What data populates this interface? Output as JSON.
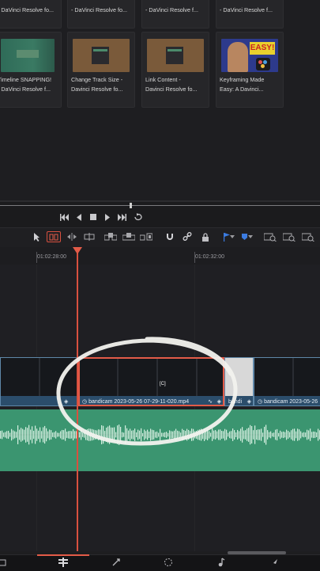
{
  "media_pool": {
    "top_row": [
      {
        "title": "- DaVinci Resolve fo..."
      },
      {
        "title": "- DaVinci Resolve f..."
      },
      {
        "title": "- DaVinci Resolve f..."
      }
    ],
    "second_row": [
      {
        "title_line1": "Timeline SNAPPING!",
        "title_line2": "- DaVinci Resolve f..."
      },
      {
        "title_line1": "Change Track Size -",
        "title_line2": "Davinci Resolve fo..."
      },
      {
        "title_line1": "Link Content -",
        "title_line2": "Davinci Resolve fo..."
      },
      {
        "title_line1": "Keyframing Made",
        "title_line2": "Easy: A Davinci..."
      }
    ],
    "keyframe_thumb_badge": "EASY!",
    "first_top_title": "- DaVinci Resolve fo..."
  },
  "timeline": {
    "timecode_left": "01:02:28:00",
    "timecode_right": "01:02:32:00",
    "video_clips": [
      {
        "name": ""
      },
      {
        "name": "bandicam 2023-05-26 07-29-11-020.mp4"
      },
      {
        "name": "bandi"
      },
      {
        "name": "bandicam 2023-05-26"
      }
    ],
    "clip_badge": "[C]"
  },
  "colors": {
    "playhead": "#e35b48",
    "video_clip": "#2b4d6b",
    "audio_clip": "#3b9570"
  }
}
